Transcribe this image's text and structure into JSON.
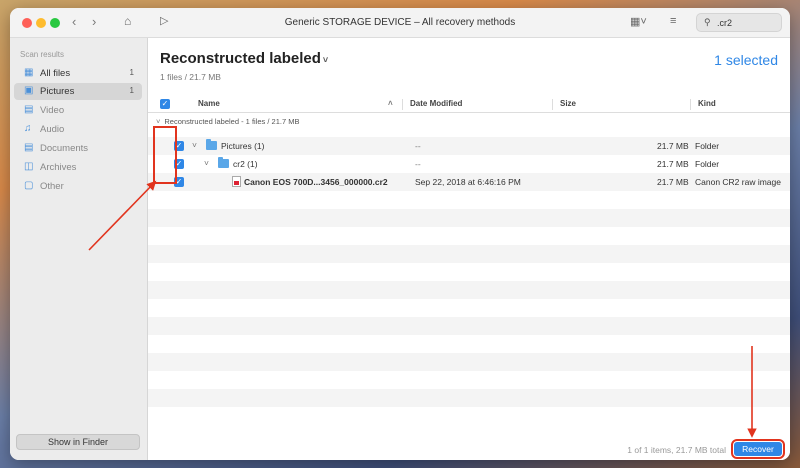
{
  "window": {
    "title": "Generic STORAGE DEVICE – All recovery methods",
    "search_value": ".cr2"
  },
  "toolbar": {
    "back_icon": "chevron-left-icon",
    "forward_icon": "chevron-right-icon",
    "home_icon": "home-icon",
    "play_icon": "play-circle-icon",
    "view_icon": "grid-view-icon",
    "filter_icon": "sliders-icon",
    "search_icon": "search-icon"
  },
  "sidebar": {
    "header": "Scan results",
    "items": [
      {
        "label": "All files",
        "count": "1",
        "icon": "all-files-icon"
      },
      {
        "label": "Pictures",
        "count": "1",
        "icon": "pictures-icon"
      },
      {
        "label": "Video",
        "count": "",
        "icon": "video-icon"
      },
      {
        "label": "Audio",
        "count": "",
        "icon": "audio-icon"
      },
      {
        "label": "Documents",
        "count": "",
        "icon": "documents-icon"
      },
      {
        "label": "Archives",
        "count": "",
        "icon": "archives-icon"
      },
      {
        "label": "Other",
        "count": "",
        "icon": "other-icon"
      }
    ],
    "show_in_finder": "Show in Finder"
  },
  "main": {
    "title": "Reconstructed labeled",
    "subtitle": "1 files / 21.7 MB",
    "selected": "1 selected",
    "columns": {
      "name": "Name",
      "date": "Date Modified",
      "size": "Size",
      "kind": "Kind"
    },
    "group_label": "Reconstructed labeled - 1 files / 21.7 MB",
    "rows": [
      {
        "name": "Pictures (1)",
        "date": "--",
        "size": "21.7 MB",
        "kind": "Folder",
        "checked": true
      },
      {
        "name": "cr2 (1)",
        "date": "--",
        "size": "21.7 MB",
        "kind": "Folder",
        "checked": true
      },
      {
        "name": "Canon EOS 700D...3456_000000.cr2",
        "date": "Sep 22, 2018 at 6:46:16 PM",
        "size": "21.7 MB",
        "kind": "Canon CR2 raw image",
        "checked": true
      }
    ],
    "status": "1 of 1 items, 21.7 MB total",
    "recover": "Recover"
  },
  "colors": {
    "accent": "#2f87e6",
    "annotation": "#e1341e"
  }
}
